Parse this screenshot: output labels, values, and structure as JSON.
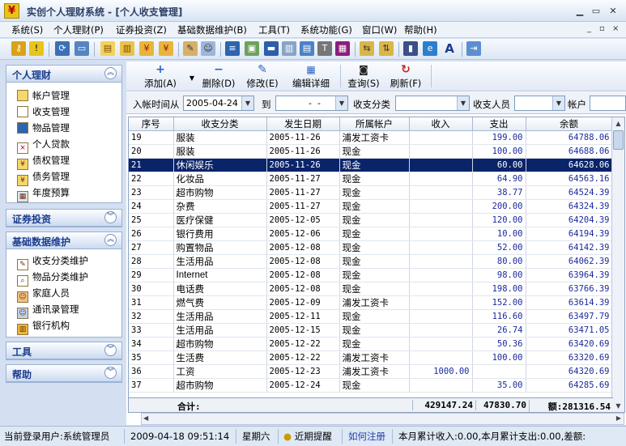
{
  "window": {
    "title": "实创个人理财系统 - [个人收支管理]"
  },
  "menu": [
    "系统(S)",
    "个人理财(P)",
    "证券投资(Z)",
    "基础数据维护(B)",
    "工具(T)",
    "系统功能(G)",
    "窗口(W)",
    "帮助(H)"
  ],
  "sidebar": {
    "personal": {
      "title": "个人理财",
      "items": [
        "帐户管理",
        "收支管理",
        "物品管理",
        "个人贷款",
        "债权管理",
        "债务管理",
        "年度预算"
      ]
    },
    "securities": {
      "title": "证券投资"
    },
    "basedata": {
      "title": "基础数据维护",
      "items": [
        "收支分类维护",
        "物品分类维护",
        "家庭人员",
        "通讯录管理",
        "银行机构"
      ]
    },
    "tools": {
      "title": "工具"
    },
    "help": {
      "title": "帮助"
    }
  },
  "actions": {
    "add": "添加(A)",
    "delete": "删除(D)",
    "edit": "修改(E)",
    "detail": "编辑详细",
    "query": "查询(S)",
    "refresh": "刷新(F)"
  },
  "filter": {
    "date_from_label": "入帐时间从",
    "date_from": "2005-04-24",
    "to_label": "到",
    "date_to": "  -  -",
    "category_label": "收支分类",
    "person_label": "收支人员",
    "account_label": "帐户"
  },
  "table": {
    "headers": [
      "序号",
      "收支分类",
      "发生日期",
      "所属帐户",
      "收入",
      "支出",
      "余额"
    ],
    "selected_row": 2,
    "rows": [
      [
        "19",
        "服装",
        "2005-11-26",
        "浦发工资卡",
        "",
        "199.00",
        "64788.06"
      ],
      [
        "20",
        "服装",
        "2005-11-26",
        "现金",
        "",
        "100.00",
        "64688.06"
      ],
      [
        "21",
        "休闲娱乐",
        "2005-11-26",
        "现金",
        "",
        "60.00",
        "64628.06"
      ],
      [
        "22",
        "化妆品",
        "2005-11-27",
        "现金",
        "",
        "64.90",
        "64563.16"
      ],
      [
        "23",
        "超市购物",
        "2005-11-27",
        "现金",
        "",
        "38.77",
        "64524.39"
      ],
      [
        "24",
        "杂费",
        "2005-11-27",
        "现金",
        "",
        "200.00",
        "64324.39"
      ],
      [
        "25",
        "医疗保健",
        "2005-12-05",
        "现金",
        "",
        "120.00",
        "64204.39"
      ],
      [
        "26",
        "银行费用",
        "2005-12-06",
        "现金",
        "",
        "10.00",
        "64194.39"
      ],
      [
        "27",
        "购置物品",
        "2005-12-08",
        "现金",
        "",
        "52.00",
        "64142.39"
      ],
      [
        "28",
        "生活用品",
        "2005-12-08",
        "现金",
        "",
        "80.00",
        "64062.39"
      ],
      [
        "29",
        "Internet",
        "2005-12-08",
        "现金",
        "",
        "98.00",
        "63964.39"
      ],
      [
        "30",
        "电话费",
        "2005-12-08",
        "现金",
        "",
        "198.00",
        "63766.39"
      ],
      [
        "31",
        "燃气费",
        "2005-12-09",
        "浦发工资卡",
        "",
        "152.00",
        "63614.39"
      ],
      [
        "32",
        "生活用品",
        "2005-12-11",
        "现金",
        "",
        "116.60",
        "63497.79"
      ],
      [
        "33",
        "生活用品",
        "2005-12-15",
        "现金",
        "",
        "26.74",
        "63471.05"
      ],
      [
        "34",
        "超市购物",
        "2005-12-22",
        "现金",
        "",
        "50.36",
        "63420.69"
      ],
      [
        "35",
        "生活费",
        "2005-12-22",
        "浦发工资卡",
        "",
        "100.00",
        "63320.69"
      ],
      [
        "36",
        "工资",
        "2005-12-23",
        "浦发工资卡",
        "1000.00",
        "",
        "64320.69"
      ],
      [
        "37",
        "超市购物",
        "2005-12-24",
        "现金",
        "",
        "35.00",
        "64285.69"
      ]
    ],
    "total": {
      "label": "合计:",
      "income": "429147.24",
      "expense": "47830.70",
      "balance": "额:281316.54"
    }
  },
  "status": {
    "user": "当前登录用户:系统管理员",
    "datetime": "2009-04-18 09:51:14",
    "weekday": "星期六",
    "reminder": "近期提醒",
    "register": "如何注册",
    "summary": "本月累计收入:0.00,本月累计支出:0.00,差额:"
  }
}
